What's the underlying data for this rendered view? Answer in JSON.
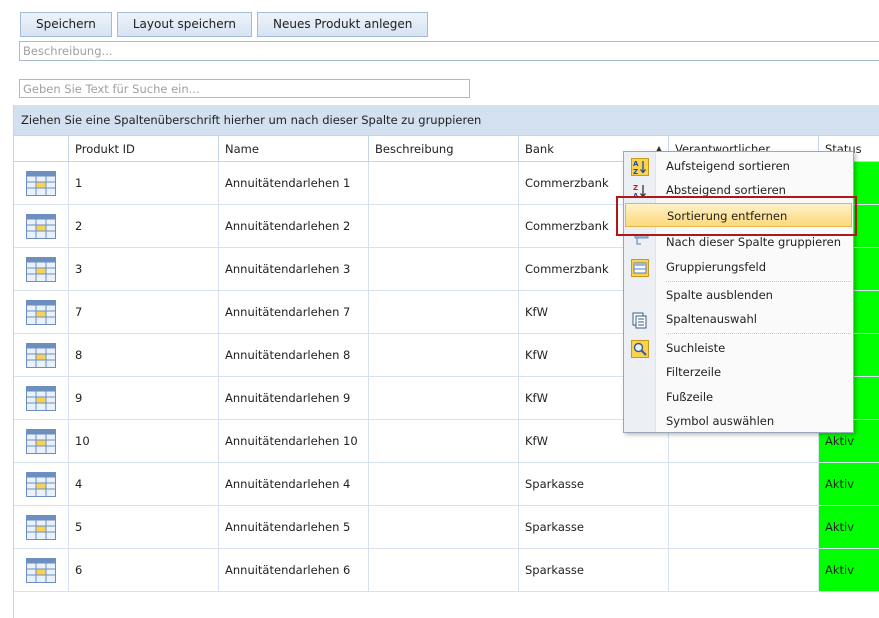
{
  "toolbar": {
    "save_label": "Speichern",
    "save_layout_label": "Layout speichern",
    "new_product_label": "Neues Produkt anlegen"
  },
  "description_field": {
    "placeholder": "Beschreibung..."
  },
  "search_field": {
    "placeholder": "Geben Sie Text für Suche ein..."
  },
  "group_panel": {
    "text": "Ziehen Sie eine Spaltenüberschrift hierher um nach dieser Spalte zu gruppieren"
  },
  "grid": {
    "columns": [
      "",
      "Produkt ID",
      "Name",
      "Beschreibung",
      "Bank",
      "Verantwortlicher",
      "Status"
    ],
    "sort_indicator": "▲",
    "rows": [
      {
        "id": "1",
        "name": "Annuitätendarlehen 1",
        "desc": "",
        "bank": "Commerzbank",
        "owner": "",
        "status": ""
      },
      {
        "id": "2",
        "name": "Annuitätendarlehen 2",
        "desc": "",
        "bank": "Commerzbank",
        "owner": "",
        "status": ""
      },
      {
        "id": "3",
        "name": "Annuitätendarlehen 3",
        "desc": "",
        "bank": "Commerzbank",
        "owner": "",
        "status": ""
      },
      {
        "id": "7",
        "name": "Annuitätendarlehen 7",
        "desc": "",
        "bank": "KfW",
        "owner": "",
        "status": ""
      },
      {
        "id": "8",
        "name": "Annuitätendarlehen 8",
        "desc": "",
        "bank": "KfW",
        "owner": "",
        "status": ""
      },
      {
        "id": "9",
        "name": "Annuitätendarlehen 9",
        "desc": "",
        "bank": "KfW",
        "owner": "",
        "status": ""
      },
      {
        "id": "10",
        "name": "Annuitätendarlehen 10",
        "desc": "",
        "bank": "KfW",
        "owner": "",
        "status": "Aktiv"
      },
      {
        "id": "4",
        "name": "Annuitätendarlehen 4",
        "desc": "",
        "bank": "Sparkasse",
        "owner": "",
        "status": "Aktiv"
      },
      {
        "id": "5",
        "name": "Annuitätendarlehen 5",
        "desc": "",
        "bank": "Sparkasse",
        "owner": "",
        "status": "Aktiv"
      },
      {
        "id": "6",
        "name": "Annuitätendarlehen 6",
        "desc": "",
        "bank": "Sparkasse",
        "owner": "",
        "status": "Aktiv"
      }
    ],
    "status_color": "#00ff00",
    "row_icon": "table-edit-icon"
  },
  "context_menu": {
    "items": [
      {
        "label": "Aufsteigend sortieren",
        "icon": "sort-ascending-icon"
      },
      {
        "label": "Absteigend sortieren",
        "icon": "sort-descending-icon"
      },
      {
        "label": "Sortierung entfernen",
        "icon": "",
        "highlighted": true
      },
      {
        "label": "Nach dieser Spalte gruppieren",
        "icon": "group-by-column-icon"
      },
      {
        "label": "Gruppierungsfeld",
        "icon": "group-panel-icon"
      },
      {
        "label": "Spalte ausblenden",
        "icon": ""
      },
      {
        "label": "Spaltenauswahl",
        "icon": "column-chooser-icon"
      },
      {
        "label": "Suchleiste",
        "icon": "search-panel-icon"
      },
      {
        "label": "Filterzeile",
        "icon": ""
      },
      {
        "label": "Fußzeile",
        "icon": ""
      },
      {
        "label": "Symbol auswählen",
        "icon": ""
      }
    ]
  },
  "colors": {
    "accent": "#d3e0f0",
    "highlight_outline": "#b01818"
  }
}
